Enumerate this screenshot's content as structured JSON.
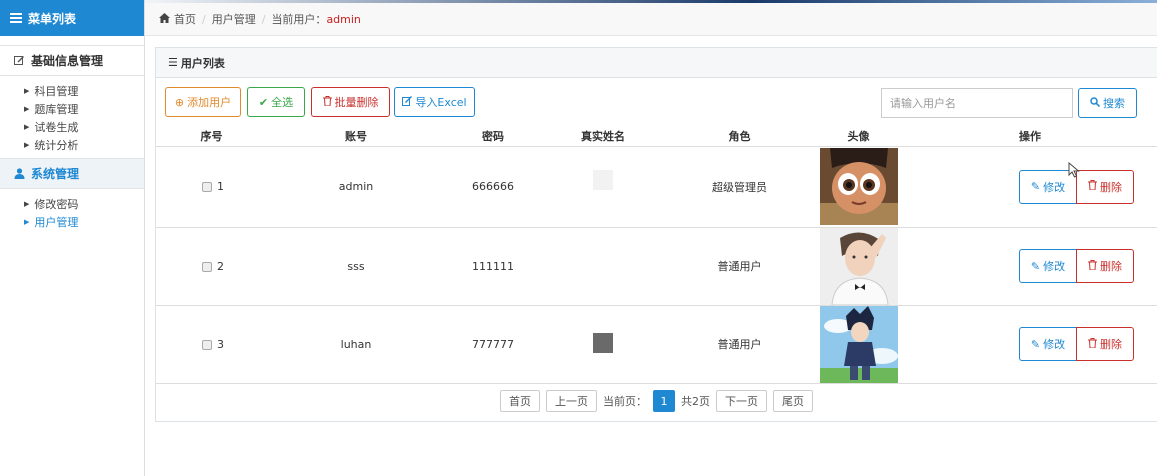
{
  "sidebar": {
    "title": "菜单列表",
    "groups": [
      {
        "label": "基础信息管理",
        "items": [
          "科目管理",
          "题库管理",
          "试卷生成",
          "统计分析"
        ]
      },
      {
        "label": "系统管理",
        "items": [
          "修改密码",
          "用户管理"
        ]
      }
    ]
  },
  "breadcrumb": {
    "home": "首页",
    "section": "用户管理",
    "current_prefix": "当前用户：",
    "current_user": "admin"
  },
  "panel": {
    "title": "用户列表"
  },
  "toolbar": {
    "add": "添加用户",
    "select_all": "全选",
    "batch_delete": "批量删除",
    "import": "导入Excel",
    "search_placeholder": "请输入用户名",
    "search": "搜索"
  },
  "table": {
    "headers": [
      "序号",
      "账号",
      "密码",
      "真实姓名",
      "角色",
      "头像",
      "操作"
    ],
    "rows": [
      {
        "num": "1",
        "account": "admin",
        "password": "666666",
        "role": "超级管理员",
        "name_swatch": "#f2f2f2",
        "avatar": "cartoon-girl-avatar"
      },
      {
        "num": "2",
        "account": "sss",
        "password": "111111",
        "role": "普通用户",
        "name_swatch": "#ffffff",
        "avatar": "man-portrait-avatar"
      },
      {
        "num": "3",
        "account": "luhan",
        "password": "777777",
        "role": "普通用户",
        "name_swatch": "#6a6a6a",
        "avatar": "anime-boy-avatar"
      }
    ],
    "edit_label": "修改",
    "delete_label": "删除"
  },
  "pager": {
    "first": "首页",
    "prev": "上一页",
    "current_label": "当前页：",
    "current": "1",
    "total": "共2页",
    "next": "下一页",
    "last": "尾页"
  },
  "colors": {
    "primary": "#1e88d2",
    "danger": "#c9302c",
    "warning": "#e08a2c",
    "success": "#3aa84a"
  }
}
